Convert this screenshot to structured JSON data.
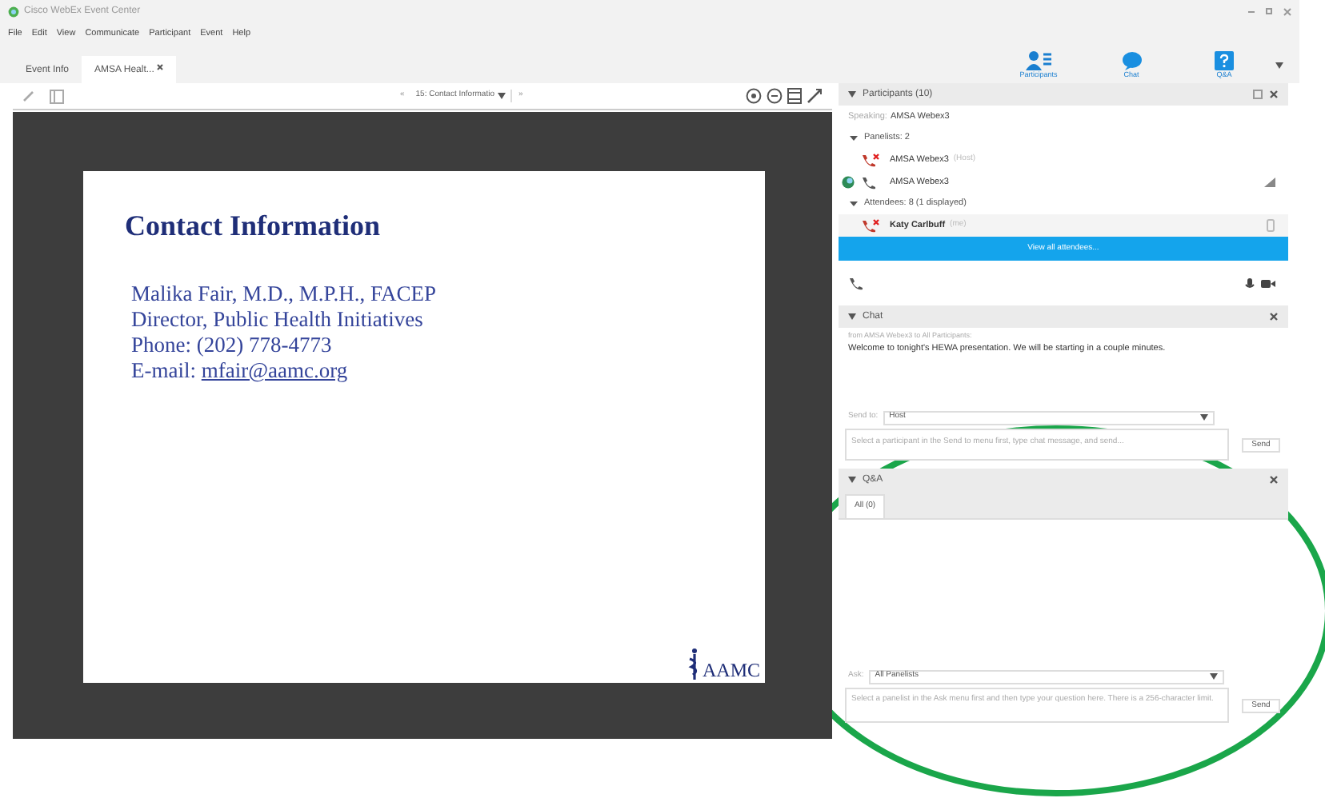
{
  "window": {
    "title": "Cisco WebEx Event Center"
  },
  "menu": [
    "File",
    "Edit",
    "View",
    "Communicate",
    "Participant",
    "Event",
    "Help"
  ],
  "tabs": [
    {
      "label": "Event Info",
      "selected": false
    },
    {
      "label": "AMSA Healt...",
      "selected": true
    }
  ],
  "ribbon": [
    {
      "kind": "participants",
      "label": "Participants"
    },
    {
      "kind": "chat",
      "label": "Chat"
    },
    {
      "kind": "qa",
      "label": "Q&A"
    }
  ],
  "toolbar": {
    "previous": "«",
    "page": "15: Contact Informatio",
    "next": "»"
  },
  "slide": {
    "title": "Contact Information",
    "lines": [
      "Malika Fair, M.D., M.P.H., FACEP",
      "Director, Public Health Initiatives",
      "Phone: (202) 778-4773"
    ],
    "email": {
      "label": "E-mail:",
      "address": "mfair@aamc.org"
    },
    "logo": "AAMC"
  },
  "participants": {
    "title": "Participants (10)",
    "speaking_label": "Speaking:",
    "speaking": "AMSA Webex3",
    "groups": [
      {
        "label": "Panelists: 2",
        "expanded": true,
        "children": [
          {
            "name": "AMSA Webex3",
            "tag": "(Host)",
            "muted": true,
            "presenter": false,
            "self": false,
            "selected": false
          },
          {
            "name": "AMSA Webex3",
            "muted": false,
            "presenter": true,
            "self": false,
            "selected": false
          }
        ]
      },
      {
        "label": "Attendees: 8 (1 displayed)",
        "expanded": true,
        "children": [
          {
            "name": "Katy Carlbuff",
            "tag": "(me)",
            "muted": true,
            "presenter": false,
            "self": true,
            "selected": true
          }
        ]
      }
    ],
    "view_all": "View all attendees..."
  },
  "chat": {
    "title": "Chat",
    "from": "from AMSA Webex3 to All Participants:",
    "message": "Welcome to tonight's HEWA presentation. We will be starting in a couple minutes.",
    "send_to_label": "Send to:",
    "send_to": "Host",
    "placeholder": "Select a participant in the Send to menu first, type chat message, and send...",
    "send": "Send"
  },
  "qa": {
    "title": "Q&A",
    "tabs": [
      {
        "label": "All (0)",
        "selected": true
      }
    ],
    "ask_label": "Ask:",
    "ask": "All Panelists",
    "placeholder": "Select a panelist in the Ask menu first and then type your question here. There is a 256-character limit.",
    "send": "Send"
  }
}
